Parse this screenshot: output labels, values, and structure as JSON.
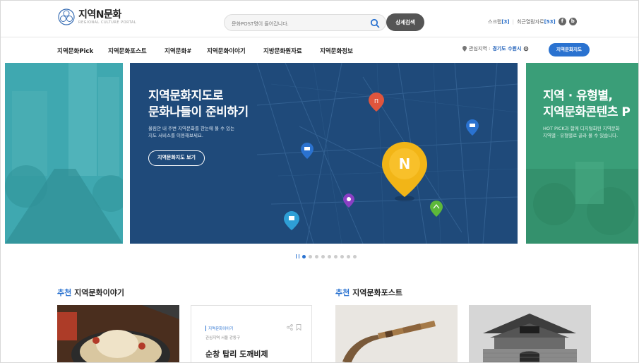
{
  "header": {
    "logo_title": "지역N문화",
    "logo_sub": "REGIONAL CULTURE PORTAL",
    "search_placeholder": "문화POST명이 들어갑니다.",
    "advanced_search": "상세검색",
    "scrap_label": "스크랩",
    "scrap_count": "[3]",
    "recent_label": "최근열람자료",
    "recent_count": "[53]"
  },
  "nav": {
    "items": [
      "지역문화Pick",
      "지역문화포스트",
      "지역문화#",
      "지역문화이야기",
      "지방문화원자료",
      "지역문화정보"
    ],
    "interest_label": "관심지역 :",
    "interest_value": "경기도 수원시",
    "map_button": "지역문화지도"
  },
  "carousel": {
    "main": {
      "title_line1": "지역문화지도로",
      "title_line2": "문화나들이 준비하기",
      "desc_line1": "올림안 내 주변 지역문화를 한눈에 볼 수 있는",
      "desc_line2": "지도 서비스를 이용해보세요.",
      "button": "지역문화지도 보기",
      "pin_letter": "N"
    },
    "next": {
      "title_line1": "지역 · 유형별,",
      "title_line2": "지역문화콘텐츠 P",
      "desc_line1": "HOT PICK과 함께 디지털화된 지역문화",
      "desc_line2": "지역별 · 유형별로 골라 볼 수 있습니다."
    },
    "active_index": 1,
    "total": 9
  },
  "sections": {
    "story": {
      "highlight": "추천",
      "title": "지역문화이야기",
      "card_category": "지역문화이야기",
      "card_location": "관심지역 서울 강동구",
      "card_title": "순창 탑리 도깨비제"
    },
    "post": {
      "highlight": "추천",
      "title": "지역문화포스트"
    }
  },
  "colors": {
    "accent": "#2a72d0",
    "main_slide": "#1f4a7a",
    "left_slide": "#3fa8b0",
    "right_slide": "#3a9e78",
    "pin_yellow": "#f2b517"
  }
}
